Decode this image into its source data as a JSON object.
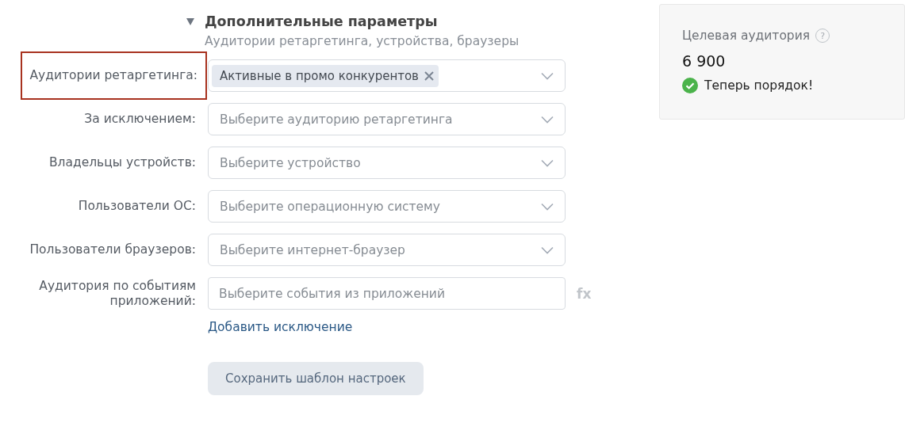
{
  "section": {
    "title": "Дополнительные параметры",
    "subtitle": "Аудитории ретаргетинга, устройства, браузеры",
    "expanded": true
  },
  "fields": [
    {
      "kind": "select",
      "label": "Аудитории ретаргетинга:",
      "highlighted": true,
      "chips": [
        "Активные в промо конкурентов"
      ]
    },
    {
      "kind": "select",
      "label": "За исключением:",
      "highlighted": false,
      "placeholder": "Выберите аудиторию ретаргетинга"
    },
    {
      "kind": "select",
      "label": "Владельцы устройств:",
      "highlighted": false,
      "placeholder": "Выберите устройство"
    },
    {
      "kind": "select",
      "label": "Пользователи ОС:",
      "highlighted": false,
      "placeholder": "Выберите операционную систему"
    },
    {
      "kind": "select",
      "label": "Пользователи браузеров:",
      "highlighted": false,
      "placeholder": "Выберите интернет-браузер"
    },
    {
      "kind": "input",
      "label": "Аудитория по событиям приложений:",
      "highlighted": false,
      "placeholder": "Выберите события из приложений",
      "suffix": "fx"
    }
  ],
  "add_exclusion_link": "Добавить исключение",
  "save_button": "Сохранить шаблон настроек",
  "audience_card": {
    "title": "Целевая аудитория",
    "help": "?",
    "value": "6 900",
    "status": "Теперь порядок!",
    "status_ok": true
  }
}
